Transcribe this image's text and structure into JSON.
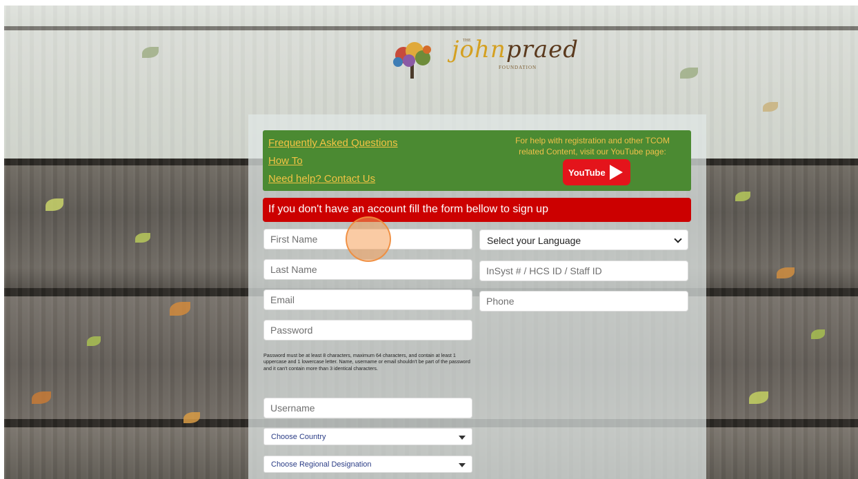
{
  "logo": {
    "alt_name": "the john praed foundation",
    "the": "THE",
    "script_jo": "john",
    "script_rest": "praed",
    "foundation": "FOUNDATION"
  },
  "help": {
    "links": [
      "Frequently Asked Questions",
      "How To",
      "Need help? Contact Us"
    ],
    "info_text": "For help with registration and other TCOM related Content, visit our YouTube page:",
    "youtube_label": "YouTube"
  },
  "alert": {
    "text": "If you don't have an account fill the form bellow to sign up"
  },
  "form": {
    "first_name": {
      "placeholder": "First Name",
      "value": ""
    },
    "last_name": {
      "placeholder": "Last Name",
      "value": ""
    },
    "email": {
      "placeholder": "Email",
      "value": ""
    },
    "password": {
      "placeholder": "Password",
      "value": ""
    },
    "password_note": "Password must be at least 8 characters, maximum 64 characters, and contain at least 1 uppercase and 1 lowercase letter. Name, username or email shouldn't be part of the password and it can't contain more than 3 identical characters.",
    "username": {
      "placeholder": "Username",
      "value": ""
    },
    "language": {
      "selected": "Select your Language"
    },
    "insyst_id": {
      "placeholder": "InSyst # / HCS ID / Staff ID",
      "value": ""
    },
    "phone": {
      "placeholder": "Phone",
      "value": ""
    },
    "country": {
      "selected": "Choose Country"
    },
    "regional": {
      "selected": "Choose Regional Designation"
    }
  },
  "colors": {
    "help_bg": "#4b8a32",
    "link": "#f3c344",
    "alert_bg": "#cc0000",
    "youtube": "#e4141b",
    "click_indicator": "#f5a05a"
  }
}
